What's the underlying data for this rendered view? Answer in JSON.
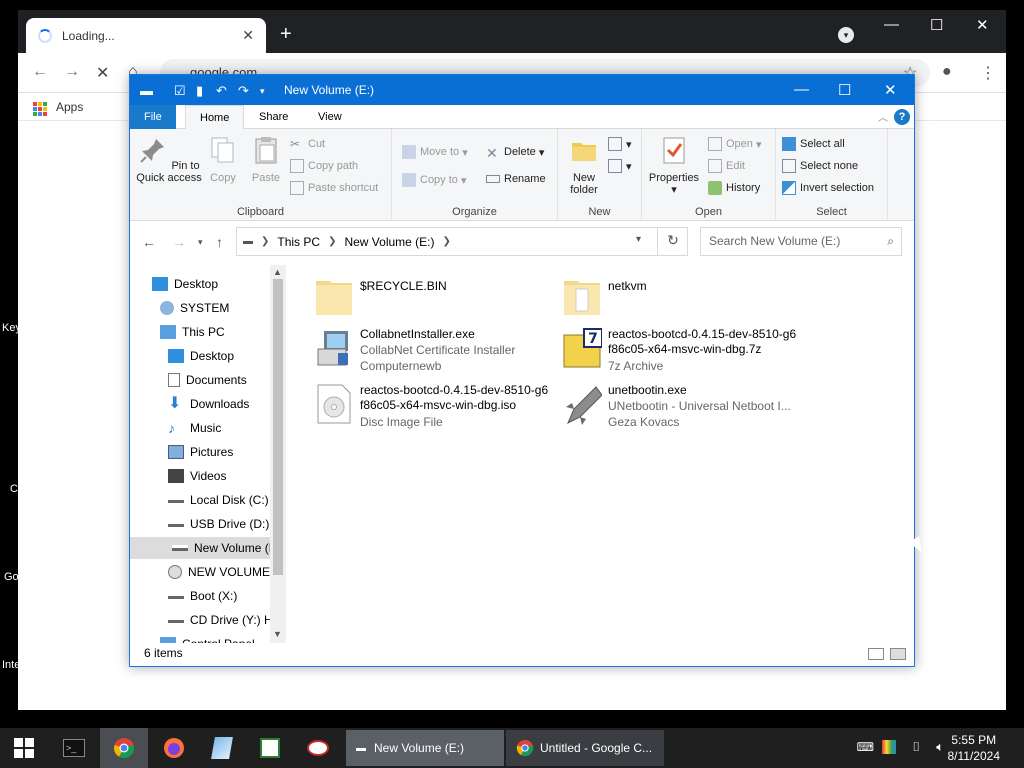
{
  "desktop": {
    "side_labels": [
      "Key",
      "C",
      "Go",
      "Inte"
    ]
  },
  "chrome": {
    "tab_title": "Loading...",
    "tab_close": "✕",
    "new_tab": "+",
    "url": "google.com",
    "bookmarks": {
      "apps_label": "Apps"
    },
    "window": {
      "minimize": "—",
      "maximize": "☐",
      "close": "✕"
    }
  },
  "explorer": {
    "title": "New Volume (E:)",
    "window": {
      "minimize": "—",
      "maximize": "☐",
      "close": "✕"
    },
    "ribbon_tabs": [
      "File",
      "Home",
      "Share",
      "View"
    ],
    "help": "?",
    "ribbon": {
      "clipboard": {
        "label": "Clipboard",
        "pin": "Pin to Quick access",
        "copy": "Copy",
        "paste": "Paste",
        "cut": "Cut",
        "copy_path": "Copy path",
        "paste_shortcut": "Paste shortcut"
      },
      "organize": {
        "label": "Organize",
        "move_to": "Move to",
        "copy_to": "Copy to",
        "delete": "Delete",
        "rename": "Rename"
      },
      "new": {
        "label": "New",
        "new_folder": "New folder"
      },
      "open": {
        "label": "Open",
        "properties": "Properties",
        "open": "Open",
        "edit": "Edit",
        "history": "History"
      },
      "select": {
        "label": "Select",
        "select_all": "Select all",
        "select_none": "Select none",
        "invert": "Invert selection"
      }
    },
    "breadcrumb": [
      "This PC",
      "New Volume (E:)"
    ],
    "search_placeholder": "Search New Volume (E:)",
    "nav": [
      {
        "label": "Desktop"
      },
      {
        "label": "SYSTEM"
      },
      {
        "label": "This PC"
      },
      {
        "label": "Desktop"
      },
      {
        "label": "Documents"
      },
      {
        "label": "Downloads"
      },
      {
        "label": "Music"
      },
      {
        "label": "Pictures"
      },
      {
        "label": "Videos"
      },
      {
        "label": "Local Disk (C:)"
      },
      {
        "label": "USB Drive (D:)"
      },
      {
        "label": "New Volume (E"
      },
      {
        "label": "NEW VOLUME"
      },
      {
        "label": "Boot (X:)"
      },
      {
        "label": "CD Drive (Y:) H"
      },
      {
        "label": "Control Panel"
      }
    ],
    "files": [
      {
        "name": "$RECYCLE.BIN",
        "desc1": "",
        "desc2": ""
      },
      {
        "name": "netkvm",
        "desc1": "",
        "desc2": ""
      },
      {
        "name": "CollabnetInstaller.exe",
        "desc1": "CollabNet Certificate Installer",
        "desc2": "Computernewb"
      },
      {
        "name": "reactos-bootcd-0.4.15-dev-8510-g6 f86c05-x64-msvc-win-dbg.7z",
        "desc1": "7z Archive",
        "desc2": ""
      },
      {
        "name": "reactos-bootcd-0.4.15-dev-8510-g6 f86c05-x64-msvc-win-dbg.iso",
        "desc1": "Disc Image File",
        "desc2": ""
      },
      {
        "name": "unetbootin.exe",
        "desc1": "UNetbootin - Universal Netboot I...",
        "desc2": "Geza Kovacs"
      }
    ],
    "status": "6 items"
  },
  "taskbar": {
    "tasks": [
      "New Volume (E:)",
      "Untitled - Google C..."
    ],
    "clock_time": "5:55 PM",
    "clock_date": "8/11/2024"
  }
}
